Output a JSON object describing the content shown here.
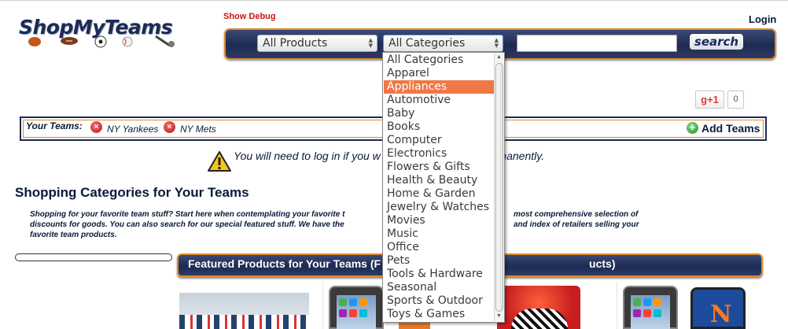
{
  "header": {
    "logo_text": "ShopMyTeams",
    "debug_link": "Show Debug",
    "login_link": "Login"
  },
  "search": {
    "products_select": "All Products",
    "categories_select": "All Categories",
    "search_value": "",
    "search_button": "search"
  },
  "social": {
    "gplus_label": "+1",
    "gplus_count": "0"
  },
  "teams": {
    "label": "Your Teams:",
    "list": [
      "NY Yankees",
      "NY Mets"
    ],
    "add_label": "Add Teams"
  },
  "warning": {
    "text": "You will need to log in if you w                              am list permanently."
  },
  "shopping": {
    "title": "Shopping Categories for Your Teams",
    "desc_lines": [
      "Shopping for your favorite team stuff? Start here when contemplating your favorite t",
      "discounts for goods. You can also search for our special featured stuff. We have the",
      "favorite team products."
    ],
    "desc_right": [
      "most comprehensive selection of",
      "and index of retailers selling your"
    ]
  },
  "featured": {
    "title_left": "Featured Products for Your Teams (F",
    "title_right": "ucts)"
  },
  "dropdown": {
    "selected": "Appliances",
    "options": [
      "All Categories",
      "Apparel",
      "Appliances",
      "Automotive",
      "Baby",
      "Books",
      "Computer",
      "Electronics",
      "Flowers & Gifts",
      "Health & Beauty",
      "Home & Garden",
      "Jewelry & Watches",
      "Movies",
      "Music",
      "Office",
      "Pets",
      "Tools & Hardware",
      "Seasonal",
      "Sports & Outdoor",
      "Toys & Games"
    ]
  },
  "colors": {
    "navy": "#1d2a52",
    "accent_orange": "#e08a2a",
    "selected_option": "#f07746"
  }
}
